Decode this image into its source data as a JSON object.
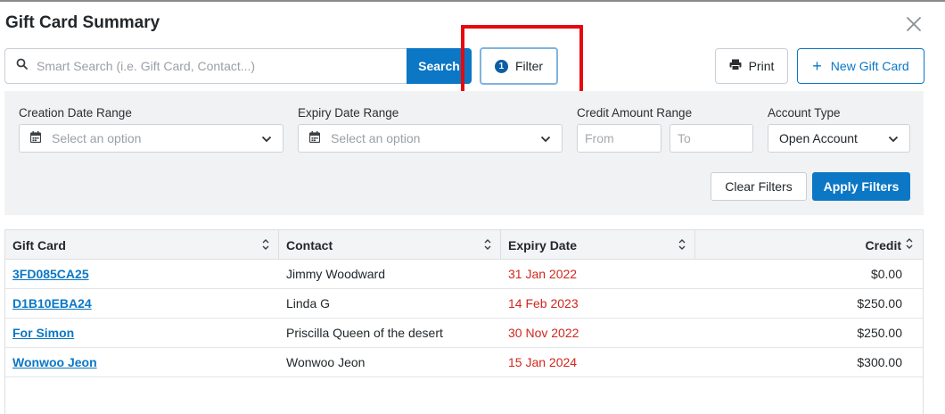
{
  "title": "Gift Card Summary",
  "search": {
    "placeholder": "Smart Search (i.e. Gift Card, Contact...)",
    "button_label": "Search"
  },
  "toolbar": {
    "filter_label": "Filter",
    "filter_count": "1",
    "print_label": "Print",
    "new_gift_card_label": "New Gift Card"
  },
  "filters": {
    "creation_date": {
      "label": "Creation Date Range",
      "placeholder": "Select an option"
    },
    "expiry_date": {
      "label": "Expiry Date Range",
      "placeholder": "Select an option"
    },
    "credit_amount": {
      "label": "Credit Amount Range",
      "from_placeholder": "From",
      "to_placeholder": "To"
    },
    "account_type": {
      "label": "Account Type",
      "value": "Open Account"
    },
    "clear_label": "Clear Filters",
    "apply_label": "Apply Filters"
  },
  "table": {
    "columns": [
      "Gift Card",
      "Contact",
      "Expiry Date",
      "Credit"
    ],
    "rows": [
      {
        "gift_card": "3FD085CA25",
        "contact": "Jimmy Woodward",
        "expiry": "31 Jan 2022",
        "credit": "$0.00"
      },
      {
        "gift_card": "D1B10EBA24",
        "contact": "Linda G",
        "expiry": "14 Feb 2023",
        "credit": "$250.00"
      },
      {
        "gift_card": "For Simon",
        "contact": "Priscilla Queen of the desert",
        "expiry": "30 Nov 2022",
        "credit": "$250.00"
      },
      {
        "gift_card": "Wonwoo Jeon",
        "contact": "Wonwoo Jeon",
        "expiry": "15 Jan 2024",
        "credit": "$300.00"
      }
    ]
  },
  "icons": {
    "search": "search-icon",
    "close": "close-icon",
    "print": "printer-icon",
    "add": "plus-icon",
    "calendar": "calendar-icon",
    "dropdown": "chevron-down-icon",
    "sort": "sort-icon"
  },
  "colors": {
    "accent": "#0b77c5",
    "expiry_text": "#d0271d",
    "highlight": "#e8070d",
    "panel_bg": "#f1f2f3"
  }
}
